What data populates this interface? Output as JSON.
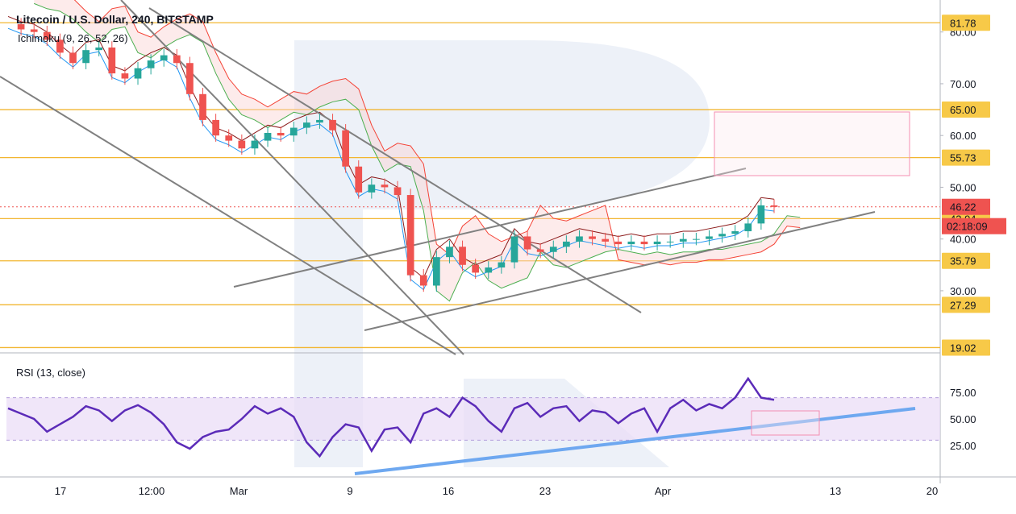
{
  "chart_data": {
    "type": "candlestick",
    "title": "Litecoin / U.S. Dollar, 240, BITSTAMP",
    "indicator_label": "Ichimoku (9, 26, 52, 26)",
    "rsi_label": "RSI (13, close)",
    "x_tick_labels": [
      "17",
      "12:00",
      "Mar",
      "9",
      "16",
      "23",
      "Apr",
      "13",
      "20"
    ],
    "y_tick_labels": [
      "80.00",
      "70.00",
      "60.00",
      "50.00",
      "40.00",
      "30.00"
    ],
    "rsi_tick_labels": [
      "75.00",
      "50.00",
      "25.00"
    ],
    "ylim": [
      18,
      84
    ],
    "rsi_ylim": [
      0,
      100
    ],
    "horizontal_levels": [
      {
        "label": "81.78",
        "value": 81.78
      },
      {
        "label": "65.00",
        "value": 65.0
      },
      {
        "label": "55.73",
        "value": 55.73
      },
      {
        "label": "43.94",
        "value": 43.94
      },
      {
        "label": "35.79",
        "value": 35.79
      },
      {
        "label": "27.29",
        "value": 27.29
      },
      {
        "label": "19.02",
        "value": 19.02
      }
    ],
    "current_price": {
      "label": "46.22",
      "value": 46.22
    },
    "countdown": "02:18:09",
    "colors": {
      "level_line": "#f2b630",
      "level_badge": "#f7c948",
      "price_badge": "#ef5350",
      "up_candle": "#26a69a",
      "down_candle": "#ef5350",
      "rsi_line": "#5b2bb8",
      "rsi_band": "#e9dcf7",
      "trend_blue": "#6ea8f0",
      "channel_line": "#808080",
      "target_box": "#f48fb1"
    },
    "price_series": [
      {
        "x": 0,
        "y": 81.5
      },
      {
        "x": 2,
        "y": 80.5
      },
      {
        "x": 4,
        "y": 80.0
      },
      {
        "x": 6,
        "y": 78.5
      },
      {
        "x": 8,
        "y": 76.0
      },
      {
        "x": 10,
        "y": 74.0
      },
      {
        "x": 12,
        "y": 76.5
      },
      {
        "x": 14,
        "y": 77.0
      },
      {
        "x": 16,
        "y": 72.0
      },
      {
        "x": 18,
        "y": 71.0
      },
      {
        "x": 20,
        "y": 73.0
      },
      {
        "x": 22,
        "y": 74.5
      },
      {
        "x": 24,
        "y": 75.5
      },
      {
        "x": 26,
        "y": 74.0
      },
      {
        "x": 28,
        "y": 68.0
      },
      {
        "x": 30,
        "y": 63.0
      },
      {
        "x": 32,
        "y": 60.0
      },
      {
        "x": 34,
        "y": 59.0
      },
      {
        "x": 36,
        "y": 57.5
      },
      {
        "x": 38,
        "y": 59.0
      },
      {
        "x": 40,
        "y": 60.5
      },
      {
        "x": 42,
        "y": 60.0
      },
      {
        "x": 44,
        "y": 61.5
      },
      {
        "x": 46,
        "y": 62.5
      },
      {
        "x": 48,
        "y": 63.0
      },
      {
        "x": 50,
        "y": 61.0
      },
      {
        "x": 52,
        "y": 54.0
      },
      {
        "x": 54,
        "y": 49.0
      },
      {
        "x": 56,
        "y": 50.5
      },
      {
        "x": 58,
        "y": 50.0
      },
      {
        "x": 60,
        "y": 48.5
      },
      {
        "x": 62,
        "y": 33.0
      },
      {
        "x": 64,
        "y": 31.0
      },
      {
        "x": 66,
        "y": 36.5
      },
      {
        "x": 68,
        "y": 38.5
      },
      {
        "x": 70,
        "y": 35.0
      },
      {
        "x": 72,
        "y": 33.5
      },
      {
        "x": 74,
        "y": 34.5
      },
      {
        "x": 76,
        "y": 35.5
      },
      {
        "x": 78,
        "y": 40.5
      },
      {
        "x": 80,
        "y": 38.0
      },
      {
        "x": 82,
        "y": 37.5
      },
      {
        "x": 84,
        "y": 38.5
      },
      {
        "x": 86,
        "y": 39.5
      },
      {
        "x": 88,
        "y": 40.5
      },
      {
        "x": 90,
        "y": 40.0
      },
      {
        "x": 92,
        "y": 39.5
      },
      {
        "x": 94,
        "y": 39.0
      },
      {
        "x": 96,
        "y": 39.5
      },
      {
        "x": 98,
        "y": 39.0
      },
      {
        "x": 100,
        "y": 39.5
      },
      {
        "x": 102,
        "y": 39.5
      },
      {
        "x": 104,
        "y": 40.0
      },
      {
        "x": 106,
        "y": 40.0
      },
      {
        "x": 108,
        "y": 40.5
      },
      {
        "x": 110,
        "y": 41.0
      },
      {
        "x": 112,
        "y": 41.5
      },
      {
        "x": 114,
        "y": 43.0
      },
      {
        "x": 116,
        "y": 46.5
      },
      {
        "x": 118,
        "y": 46.2
      }
    ],
    "rsi_series": [
      {
        "x": 0,
        "y": 60
      },
      {
        "x": 2,
        "y": 55
      },
      {
        "x": 4,
        "y": 50
      },
      {
        "x": 6,
        "y": 38
      },
      {
        "x": 8,
        "y": 45
      },
      {
        "x": 10,
        "y": 52
      },
      {
        "x": 12,
        "y": 62
      },
      {
        "x": 14,
        "y": 58
      },
      {
        "x": 16,
        "y": 48
      },
      {
        "x": 18,
        "y": 58
      },
      {
        "x": 20,
        "y": 63
      },
      {
        "x": 22,
        "y": 56
      },
      {
        "x": 24,
        "y": 45
      },
      {
        "x": 26,
        "y": 28
      },
      {
        "x": 28,
        "y": 22
      },
      {
        "x": 30,
        "y": 33
      },
      {
        "x": 32,
        "y": 38
      },
      {
        "x": 34,
        "y": 40
      },
      {
        "x": 36,
        "y": 50
      },
      {
        "x": 38,
        "y": 62
      },
      {
        "x": 40,
        "y": 55
      },
      {
        "x": 42,
        "y": 60
      },
      {
        "x": 44,
        "y": 52
      },
      {
        "x": 46,
        "y": 28
      },
      {
        "x": 48,
        "y": 15
      },
      {
        "x": 50,
        "y": 33
      },
      {
        "x": 52,
        "y": 45
      },
      {
        "x": 54,
        "y": 42
      },
      {
        "x": 56,
        "y": 20
      },
      {
        "x": 58,
        "y": 40
      },
      {
        "x": 60,
        "y": 42
      },
      {
        "x": 62,
        "y": 28
      },
      {
        "x": 64,
        "y": 55
      },
      {
        "x": 66,
        "y": 60
      },
      {
        "x": 68,
        "y": 52
      },
      {
        "x": 70,
        "y": 70
      },
      {
        "x": 72,
        "y": 62
      },
      {
        "x": 74,
        "y": 48
      },
      {
        "x": 76,
        "y": 38
      },
      {
        "x": 78,
        "y": 60
      },
      {
        "x": 80,
        "y": 65
      },
      {
        "x": 82,
        "y": 52
      },
      {
        "x": 84,
        "y": 60
      },
      {
        "x": 86,
        "y": 62
      },
      {
        "x": 88,
        "y": 48
      },
      {
        "x": 90,
        "y": 58
      },
      {
        "x": 92,
        "y": 56
      },
      {
        "x": 94,
        "y": 46
      },
      {
        "x": 96,
        "y": 55
      },
      {
        "x": 98,
        "y": 60
      },
      {
        "x": 100,
        "y": 38
      },
      {
        "x": 102,
        "y": 60
      },
      {
        "x": 104,
        "y": 68
      },
      {
        "x": 106,
        "y": 58
      },
      {
        "x": 108,
        "y": 64
      },
      {
        "x": 110,
        "y": 60
      },
      {
        "x": 112,
        "y": 70
      },
      {
        "x": 114,
        "y": 88
      },
      {
        "x": 116,
        "y": 70
      },
      {
        "x": 118,
        "y": 68
      }
    ]
  }
}
